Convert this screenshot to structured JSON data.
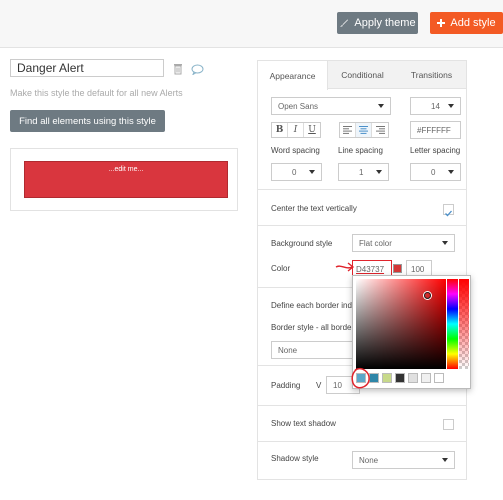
{
  "toolbar": {
    "apply_theme_label": "Apply theme",
    "add_style_label": "Add style"
  },
  "style_editor": {
    "style_name": "Danger Alert",
    "default_hint": "Make this style the default for all new Alerts",
    "find_button_label": "Find all elements using this style",
    "preview_text": "...edit me..."
  },
  "panel": {
    "tabs": [
      "Appearance",
      "Conditional",
      "Transitions"
    ],
    "font_family": "Open Sans",
    "font_size": "14",
    "format_buttons": [
      "B",
      "I",
      "U"
    ],
    "align_buttons": [
      "align-left-icon",
      "align-center-icon",
      "align-right-icon"
    ],
    "font_color": "#FFFFFF",
    "word_spacing_label": "Word spacing",
    "word_spacing_value": "0",
    "line_spacing_label": "Line spacing",
    "line_spacing_value": "1",
    "letter_spacing_label": "Letter spacing",
    "letter_spacing_value": "0",
    "center_vertically_label": "Center the text vertically",
    "background_style_label": "Background style",
    "background_style_value": "Flat color",
    "color_label": "Color",
    "color_value": "D43737",
    "color_opacity": "100",
    "border_define_label": "Define each border inde",
    "border_style_label": "Border style - all borders",
    "border_style_value": "None",
    "padding_label": "Padding",
    "padding_v_label": "V",
    "padding_v_value": "10",
    "text_shadow_label": "Show text shadow",
    "shadow_style_label": "Shadow style",
    "shadow_style_value": "None"
  },
  "colors": {
    "accent_orange": "#f35a24",
    "button_gray": "#6e7a82",
    "alert_red": "#d9363e",
    "annotation_red": "#e0242c",
    "swatches": [
      "#5aa7c9",
      "#2e86a8",
      "#c7d98a",
      "#333333",
      "#e0e0e0",
      "#f0f0f0",
      "#ffffff"
    ]
  }
}
